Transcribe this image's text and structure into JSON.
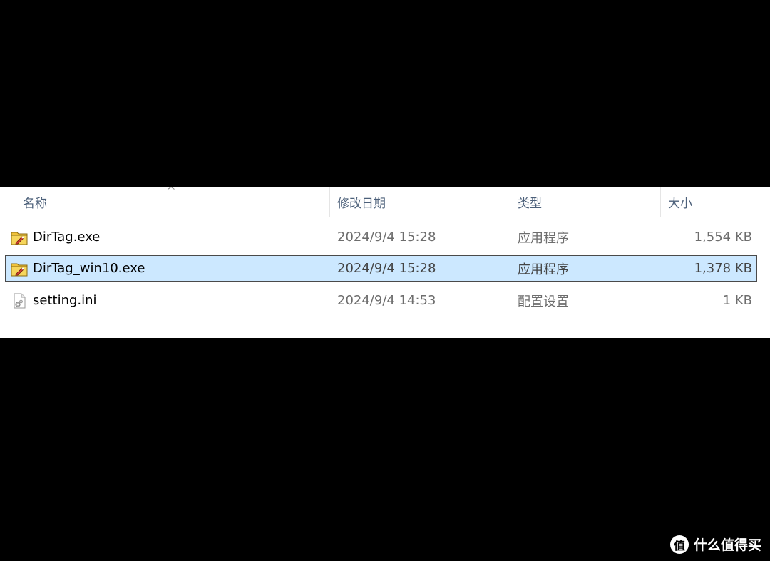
{
  "columns": {
    "name": "名称",
    "date_modified": "修改日期",
    "type": "类型",
    "size": "大小"
  },
  "files": [
    {
      "name": "DirTag.exe",
      "date_modified": "2024/9/4 15:28",
      "type": "应用程序",
      "size": "1,554 KB",
      "icon": "exe-app-icon",
      "selected": false
    },
    {
      "name": "DirTag_win10.exe",
      "date_modified": "2024/9/4 15:28",
      "type": "应用程序",
      "size": "1,378 KB",
      "icon": "exe-app-icon",
      "selected": true
    },
    {
      "name": "setting.ini",
      "date_modified": "2024/9/4 14:53",
      "type": "配置设置",
      "size": "1 KB",
      "icon": "ini-settings-file-icon",
      "selected": false
    }
  ],
  "watermark": {
    "logo_char": "值",
    "text": "什么值得买"
  },
  "colors": {
    "selection_background": "#cce8ff",
    "selection_border": "#99d1ff",
    "header_text": "#4c607a",
    "secondary_text": "#6d6d6d"
  }
}
